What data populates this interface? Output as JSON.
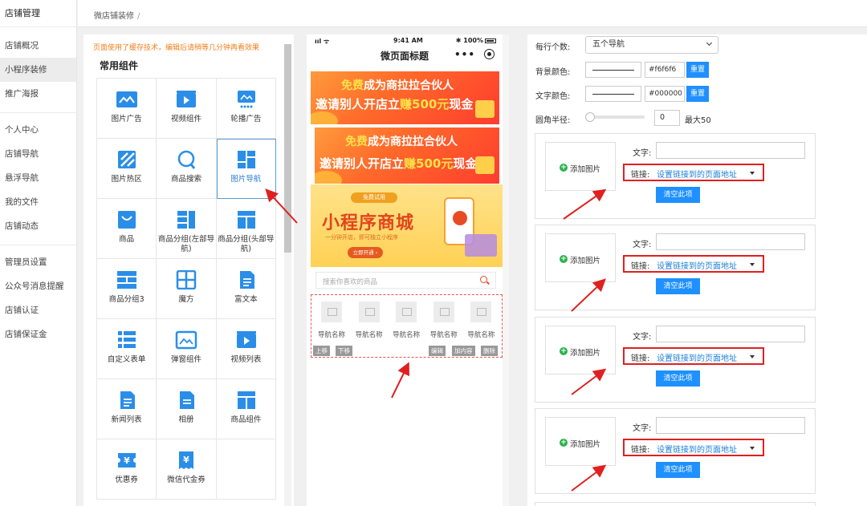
{
  "sidebar": {
    "title": "店铺管理",
    "items": [
      "店铺概况",
      "小程序装修",
      "推广海报",
      "个人中心",
      "店铺导航",
      "悬浮导航",
      "我的文件",
      "店铺动态",
      "管理员设置",
      "公众号消息提醒",
      "店铺认证",
      "店铺保证金"
    ],
    "active_index": 1
  },
  "breadcrumb": {
    "text": "微店铺装修",
    "sep": "/"
  },
  "components": {
    "cache_tip": "页面使用了缓存技术，编辑后请稍等几分钟再看效果",
    "title": "常用组件",
    "items": [
      {
        "label": "图片广告",
        "icon": "image-ad-icon"
      },
      {
        "label": "视频组件",
        "icon": "video-icon"
      },
      {
        "label": "轮播广告",
        "icon": "carousel-icon"
      },
      {
        "label": "图片热区",
        "icon": "hotspot-icon"
      },
      {
        "label": "商品搜索",
        "icon": "search-icon"
      },
      {
        "label": "图片导航",
        "icon": "image-nav-icon"
      },
      {
        "label": "商品",
        "icon": "goods-icon"
      },
      {
        "label": "商品分组(左部导航)",
        "icon": "group-left-icon"
      },
      {
        "label": "商品分组(头部导航)",
        "icon": "group-top-icon"
      },
      {
        "label": "商品分组3",
        "icon": "group3-icon"
      },
      {
        "label": "魔方",
        "icon": "cube-icon"
      },
      {
        "label": "富文本",
        "icon": "richtext-icon"
      },
      {
        "label": "自定义表单",
        "icon": "form-icon"
      },
      {
        "label": "弹窗组件",
        "icon": "popup-icon"
      },
      {
        "label": "视频列表",
        "icon": "video-list-icon"
      },
      {
        "label": "新闻列表",
        "icon": "news-icon"
      },
      {
        "label": "相册",
        "icon": "album-icon"
      },
      {
        "label": "商品组件",
        "icon": "goods-comp-icon"
      },
      {
        "label": "优惠券",
        "icon": "coupon-icon"
      },
      {
        "label": "微信代金券",
        "icon": "wechat-voucher-icon"
      }
    ],
    "selected_index": 5
  },
  "phone": {
    "time": "9:41 AM",
    "signal": "ııl ᯤ",
    "battery": "✱ 100%",
    "title": "微页面标题",
    "menu": "•••",
    "banner1_line1a": "免费",
    "banner1_line1b": "成为商拉拉合伙人",
    "banner1_line2a": "邀请别人开店立",
    "banner1_line2b": "赚500元",
    "banner1_line2c": "现金",
    "yb_tag": "免费试用",
    "yb_title": "小程序商城",
    "yb_sub": "一分钟开店，即可独立小程序",
    "yb_btn": "立即开通 ›",
    "search_placeholder": "搜索你喜欢的商品",
    "nav_label": "导航名称",
    "nav_count": 5,
    "btn_up": "上移",
    "btn_down": "下移",
    "btn_edit": "编辑",
    "btn_add": "加内容",
    "btn_del": "删除"
  },
  "settings": {
    "per_row_label": "每行个数:",
    "per_row_value": "五个导航",
    "bg_label": "背景颜色:",
    "bg_hex": "#f6f6f6",
    "text_label": "文字颜色:",
    "text_hex": "#000000",
    "reset": "重置",
    "radius_label": "圆角半径:",
    "radius_value": "0",
    "radius_max": "最大50"
  },
  "card": {
    "add_image": "添加图片",
    "text_label": "文字:",
    "link_label": "链接:",
    "link_value": "设置链接到的页面地址",
    "clear": "清空此项"
  },
  "colors": {
    "accent": "#1e90ff",
    "highlight": "#e02020",
    "tip": "#f08020"
  }
}
